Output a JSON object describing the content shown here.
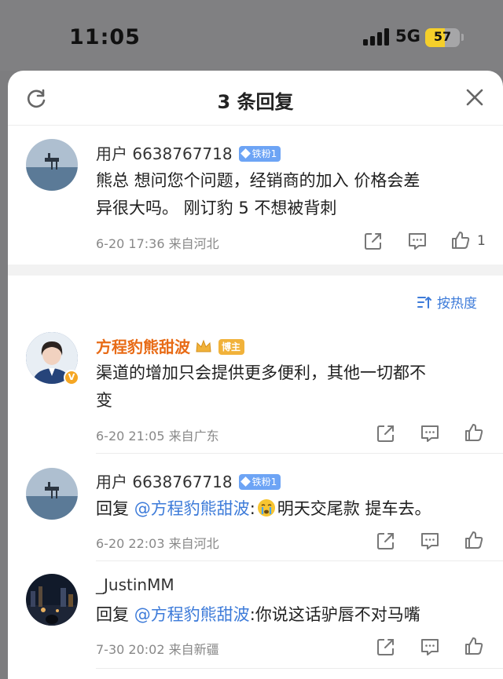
{
  "status_bar": {
    "time": "11:05",
    "network": "5G",
    "battery": "57"
  },
  "sheet": {
    "title": "3 条回复"
  },
  "main_comment": {
    "username": "用户 6638767718",
    "badge": "铁粉1",
    "text_line1": "熊总 想问您个问题，经销商的加入 价格会差",
    "text_line2": "异很大吗。 刚订豹 5 不想被背刺",
    "meta": "6-20 17:36  来自河北",
    "like_count": "1"
  },
  "sort_label": "按热度",
  "replies": [
    {
      "username": "方程豹熊甜波",
      "badge": "博主",
      "text_line1": "渠道的增加只会提供更多便利，其他一切都不",
      "text_line2": "变",
      "meta": "6-20 21:05  来自广东"
    },
    {
      "username": "用户 6638767718",
      "badge": "铁粉1",
      "reply_prefix": "回复 ",
      "mention": "@方程豹熊甜波",
      "text": "明天交尾款 提车去。",
      "meta": "6-20 22:03  来自河北"
    },
    {
      "username": "_JustinMM",
      "reply_prefix": "回复 ",
      "mention": "@方程豹熊甜波",
      "text": ":你说这话驴唇不对马嘴",
      "meta": "7-30 20:02  来自新疆"
    }
  ],
  "icons": {
    "refresh": "refresh-icon",
    "close": "close-icon",
    "share": "share-icon",
    "comment": "comment-icon",
    "like": "thumbs-up-icon",
    "crying_emoji": "crying-face-emoji",
    "crown": "crown-icon",
    "verified": "verified-v-icon",
    "sort": "sort-icon"
  },
  "colors": {
    "accent_blue": "#3d7bd9",
    "orange_name": "#e86b16",
    "badge_blue": "#6da4f5",
    "badge_gold": "#f1b23a",
    "battery_yellow": "#f5cf2a"
  }
}
